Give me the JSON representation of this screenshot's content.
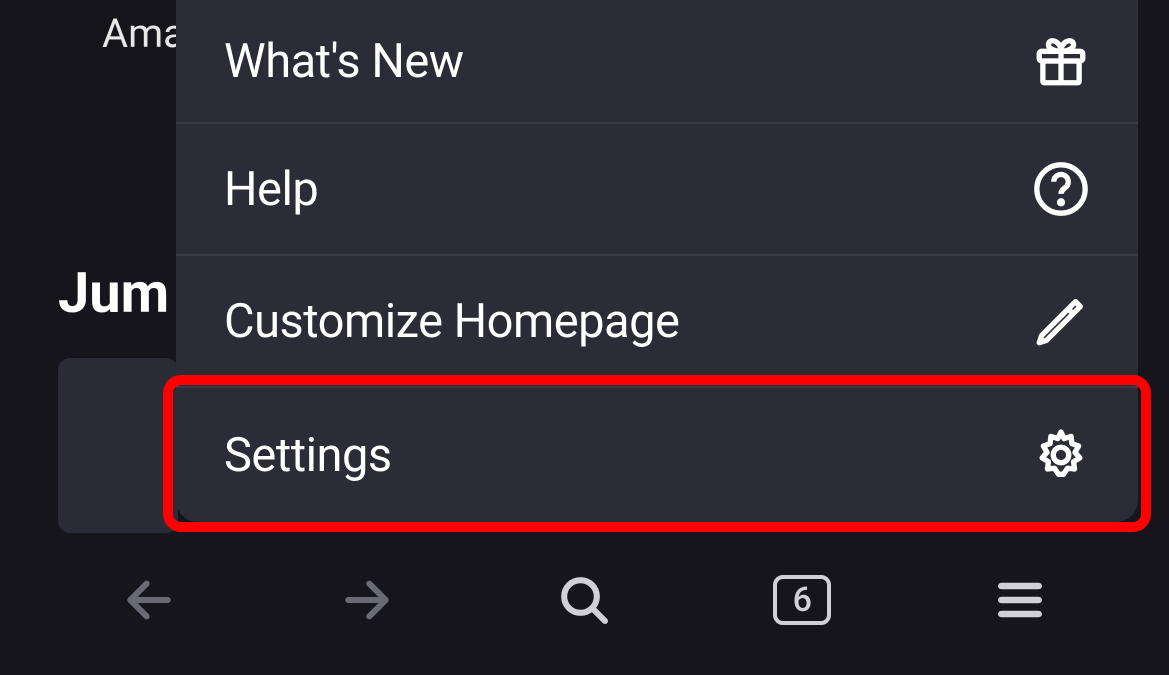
{
  "background": {
    "top_text": "Ama",
    "jump_text": "Jum"
  },
  "menu": {
    "items": [
      {
        "label": "What's New",
        "icon": "gift-icon"
      },
      {
        "label": "Help",
        "icon": "help-icon"
      },
      {
        "label": "Customize Homepage",
        "icon": "pencil-icon"
      },
      {
        "label": "Settings",
        "icon": "gear-icon"
      }
    ]
  },
  "bottom_nav": {
    "tab_count": "6"
  },
  "highlight": {
    "target": "settings-menu-item"
  }
}
